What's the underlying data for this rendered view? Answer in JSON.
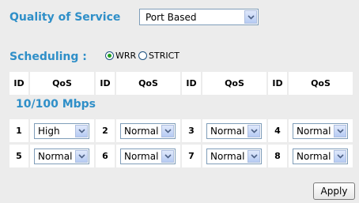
{
  "qos": {
    "title": "Quality of Service",
    "mode": "Port Based"
  },
  "scheduling": {
    "label": "Scheduling :",
    "options": [
      {
        "label": "WRR",
        "selected": true
      },
      {
        "label": "STRICT",
        "selected": false
      }
    ]
  },
  "table": {
    "id_header": "ID",
    "qos_header": "QoS",
    "section_label": "10/100 Mbps",
    "ports": [
      {
        "id": "1",
        "qos": "High"
      },
      {
        "id": "2",
        "qos": "Normal"
      },
      {
        "id": "3",
        "qos": "Normal"
      },
      {
        "id": "4",
        "qos": "Normal"
      },
      {
        "id": "5",
        "qos": "Normal"
      },
      {
        "id": "6",
        "qos": "Normal"
      },
      {
        "id": "7",
        "qos": "Normal"
      },
      {
        "id": "8",
        "qos": "Normal"
      }
    ]
  },
  "apply_label": "Apply",
  "icons": {
    "dropdown": "chevron-down-icon",
    "radio": "radio-icon"
  }
}
